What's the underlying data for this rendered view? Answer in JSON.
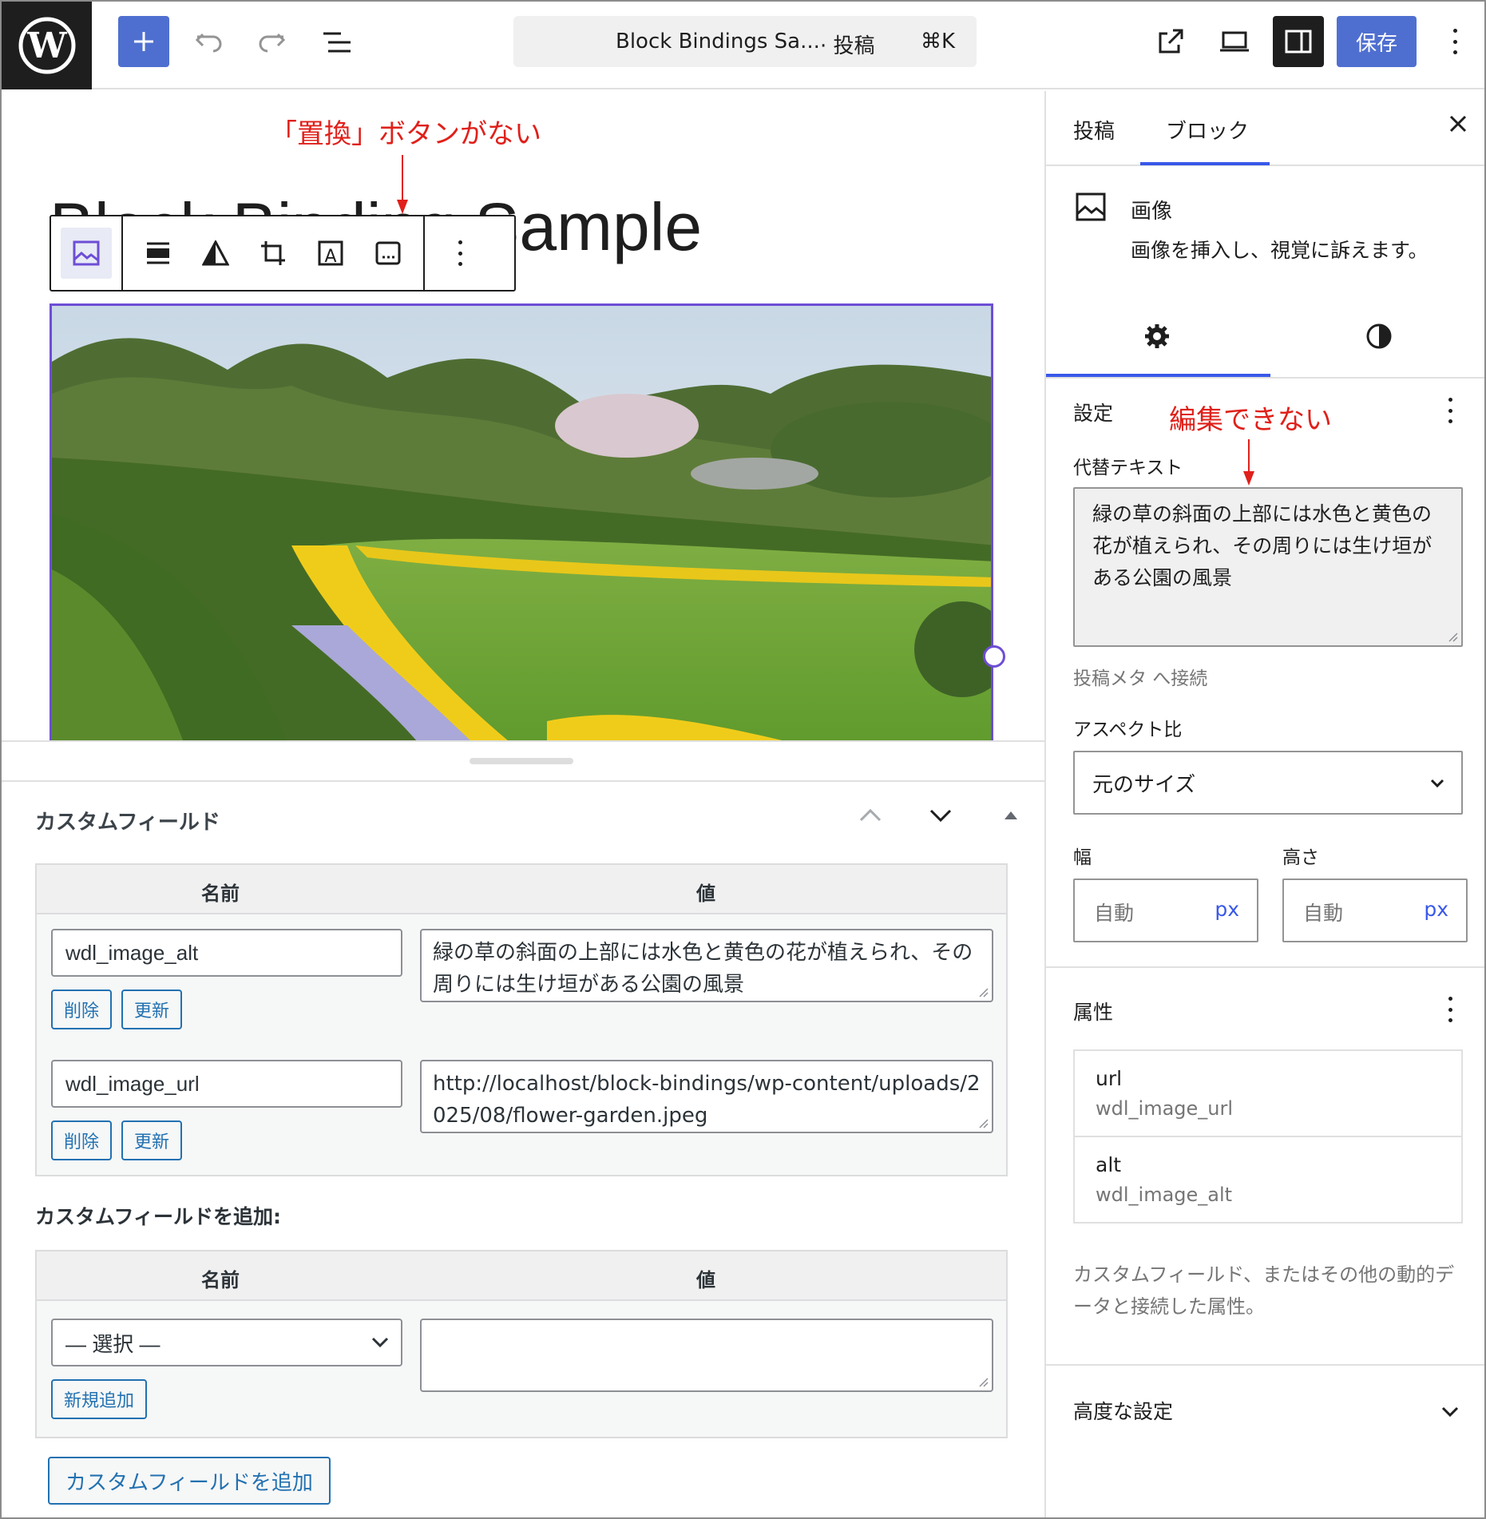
{
  "topbar": {
    "doc_title": "Block Bindings Sa...",
    "doc_type": "· 投稿",
    "shortcut": "⌘K",
    "save_label": "保存"
  },
  "canvas": {
    "post_title": "Block Binding Sample",
    "annotation_toolbar": "「置換」ボタンがない"
  },
  "meta": {
    "header": "カスタムフィールド",
    "col_name": "名前",
    "col_value": "値",
    "rows": [
      {
        "name": "wdl_image_alt",
        "value": "緑の草の斜面の上部には水色と黄色の花が植えられ、その周りには生け垣がある公園の風景",
        "delete": "削除",
        "update": "更新"
      },
      {
        "name": "wdl_image_url",
        "value": "http://localhost/block-bindings/wp-content/uploads/2025/08/flower-garden.jpeg",
        "delete": "削除",
        "update": "更新"
      }
    ],
    "add_header": "カスタムフィールドを追加:",
    "select_placeholder": "— 選択 —",
    "new_add": "新規追加",
    "add_button": "カスタムフィールドを追加"
  },
  "sidebar": {
    "tab_post": "投稿",
    "tab_block": "ブロック",
    "block_name": "画像",
    "block_desc": "画像を挿入し、視覚に訴えます。",
    "settings_label": "設定",
    "annotation_edit": "編集できない",
    "alt_label": "代替テキスト",
    "alt_value": "緑の草の斜面の上部には水色と黄色の花が植えられ、その周りには生け垣がある公園の風景",
    "connected": "投稿メタ へ接続",
    "aspect_label": "アスペクト比",
    "aspect_value": "元のサイズ",
    "width_label": "幅",
    "height_label": "高さ",
    "auto": "自動",
    "unit": "px",
    "attributes_label": "属性",
    "attributes": [
      {
        "key": "url",
        "field": "wdl_image_url"
      },
      {
        "key": "alt",
        "field": "wdl_image_alt"
      }
    ],
    "attributes_help": "カスタムフィールド、またはその他の動的データと接続した属性。",
    "advanced": "高度な設定"
  },
  "colors": {
    "accent": "#3858e9",
    "annotation": "#e0201a",
    "selection": "#6e4ed6"
  }
}
